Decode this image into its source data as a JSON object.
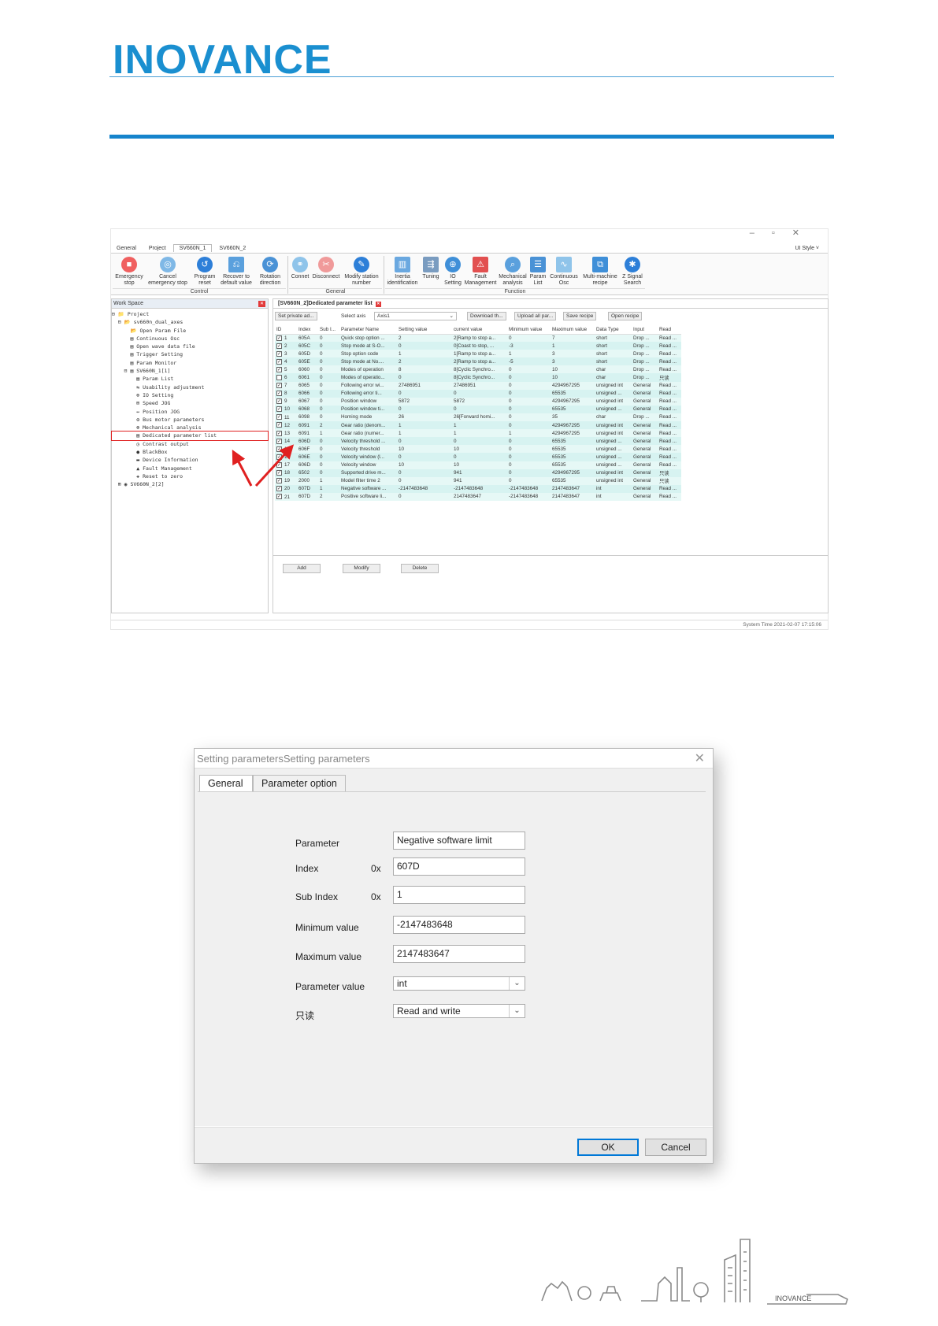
{
  "brand": {
    "logo_text": "INOVANCE",
    "color": "#1a8fd0"
  },
  "app": {
    "menu": [
      "General",
      "Project",
      "SV660N_1",
      "SV660N_2"
    ],
    "style_label": "UI Style ˅",
    "ribbon": {
      "control": [
        {
          "label": "Emergency\nstop",
          "icon": "stop-icon"
        },
        {
          "label": "Cancel\nemergency stop",
          "icon": "cancel-stop-icon"
        },
        {
          "label": "Program\nreset",
          "icon": "reset-icon"
        },
        {
          "label": "Recover to\ndefault value",
          "icon": "restore-icon"
        },
        {
          "label": "Rotation\ndirection",
          "icon": "rotation-icon"
        }
      ],
      "general": [
        {
          "label": "Connet",
          "icon": "connect-icon"
        },
        {
          "label": "Disconnect",
          "icon": "disconnect-icon"
        },
        {
          "label": "Modify station\nnumber",
          "icon": "edit-icon"
        }
      ],
      "function": [
        {
          "label": "Inertia\nidentification",
          "icon": "inertia-icon"
        },
        {
          "label": "Tuning",
          "icon": "tuning-icon"
        },
        {
          "label": "IO\nSetting",
          "icon": "io-icon"
        },
        {
          "label": "Fault\nManagement",
          "icon": "fault-icon"
        },
        {
          "label": "Mechanical\nanalysis",
          "icon": "analysis-icon"
        },
        {
          "label": "Param\nList",
          "icon": "list-icon"
        },
        {
          "label": "Continuous\nOsc",
          "icon": "osc-icon"
        },
        {
          "label": "Multi-machine\nrecipe",
          "icon": "recipe-icon"
        },
        {
          "label": "Z Signal\nSearch",
          "icon": "signal-icon"
        }
      ],
      "group_labels": [
        "Control",
        "General",
        "Function"
      ]
    },
    "workspace": {
      "title": "Work Space",
      "tree": [
        "⊟ 📁 Project",
        "  ⊟ 📂 sv660n_dual_axes",
        "      📂 Open Param File",
        "      ▤ Continuous Osc",
        "      ▤ Open wave data file",
        "      ▤ Trigger Setting",
        "      ▤ Param Monitor",
        "    ⊟ ▤ SV660N_1[1]",
        "        ▤ Param List",
        "        ⇆ Usability adjustment",
        "        ⊕ IO Setting",
        "        ⊞ Speed JOG",
        "        ↔ Position JOG",
        "        ⚙ Bus motor parameters",
        "        ⊛ Mechanical analysis",
        "        ▤ Dedicated parameter list",
        "        ◷ Contrast output",
        "        ● BlackBox",
        "        ▬ Device Information",
        "        ▲ Fault Management",
        "        ✚ Reset to zero",
        "  ⊞ ◉ SV660N_2[2]"
      ]
    },
    "pane": {
      "tab_title": "[SV660N_2]Dedicated parameter list",
      "toolbar": {
        "set_private": "Set private ad...",
        "select_axis_label": "Select axis",
        "axis_value": "Axis1",
        "download": "Download th...",
        "upload": "Upload all par...",
        "save_recipe": "Save recipe",
        "open_recipe": "Open recipe"
      },
      "columns": [
        "ID",
        "Index",
        "Sub I...",
        "Parameter Name",
        "Setting value",
        "current value",
        "Minimum value",
        "Maximum value",
        "Data Type",
        "Input",
        "Read"
      ],
      "rows": [
        [
          "1",
          "605A",
          "0",
          "Quick stop option ...",
          "2",
          "2[Ramp to stop a...",
          "0",
          "7",
          "short",
          "Drop ...",
          "Read ..."
        ],
        [
          "2",
          "605C",
          "0",
          "Stop mode at S-O...",
          "0",
          "0[Coast to stop, ...",
          "-3",
          "1",
          "short",
          "Drop ...",
          "Read ..."
        ],
        [
          "3",
          "605D",
          "0",
          "Stop option code",
          "1",
          "1[Ramp to stop a...",
          "1",
          "3",
          "short",
          "Drop ...",
          "Read ..."
        ],
        [
          "4",
          "605E",
          "0",
          "Stop mode at No....",
          "2",
          "2[Ramp to stop a...",
          "-5",
          "3",
          "short",
          "Drop ...",
          "Read ..."
        ],
        [
          "5",
          "6060",
          "0",
          "Modes of operation",
          "8",
          "8[Cyclic Synchro...",
          "0",
          "10",
          "char",
          "Drop ...",
          "Read ..."
        ],
        [
          "6",
          "6061",
          "0",
          "Modes of operatio...",
          "0",
          "8[Cyclic Synchro...",
          "0",
          "10",
          "char",
          "Drop ...",
          "只读"
        ],
        [
          "7",
          "6065",
          "0",
          "Following error wi...",
          "27486951",
          "27486951",
          "0",
          "4294967295",
          "unsigned int",
          "General",
          "Read ..."
        ],
        [
          "8",
          "6066",
          "0",
          "Following error ti...",
          "0",
          "0",
          "0",
          "65535",
          "unsigned ...",
          "General",
          "Read ..."
        ],
        [
          "9",
          "6067",
          "0",
          "Position window",
          "5872",
          "5872",
          "0",
          "4294967295",
          "unsigned int",
          "General",
          "Read ..."
        ],
        [
          "10",
          "6068",
          "0",
          "Position window ti...",
          "0",
          "0",
          "0",
          "65535",
          "unsigned ...",
          "General",
          "Read ..."
        ],
        [
          "11",
          "6098",
          "0",
          "Homing mode",
          "26",
          "26[Forward homi...",
          "0",
          "35",
          "char",
          "Drop ...",
          "Read ..."
        ],
        [
          "12",
          "6091",
          "2",
          "Gear ratio (denom...",
          "1",
          "1",
          "0",
          "4294967295",
          "unsigned int",
          "General",
          "Read ..."
        ],
        [
          "13",
          "6091",
          "1",
          "Gear ratio (numer...",
          "1",
          "1",
          "1",
          "4294967295",
          "unsigned int",
          "General",
          "Read ..."
        ],
        [
          "14",
          "606D",
          "0",
          "Velocity threshold ...",
          "0",
          "0",
          "0",
          "65535",
          "unsigned ...",
          "General",
          "Read ..."
        ],
        [
          "15",
          "606F",
          "0",
          "Velocity threshold",
          "10",
          "10",
          "0",
          "65535",
          "unsigned ...",
          "General",
          "Read ..."
        ],
        [
          "16",
          "606E",
          "0",
          "Velocity window (l...",
          "0",
          "0",
          "0",
          "65535",
          "unsigned ...",
          "General",
          "Read ..."
        ],
        [
          "17",
          "606D",
          "0",
          "Velocity window",
          "10",
          "10",
          "0",
          "65535",
          "unsigned ...",
          "General",
          "Read ..."
        ],
        [
          "18",
          "6502",
          "0",
          "Supported drive m...",
          "0",
          "941",
          "0",
          "4294967295",
          "unsigned int",
          "General",
          "只读"
        ],
        [
          "19",
          "2000",
          "1",
          "Model filter time 2",
          "0",
          "941",
          "0",
          "65535",
          "unsigned int",
          "General",
          "只读"
        ],
        [
          "20",
          "607D",
          "1",
          "Negative software ...",
          "-2147483648",
          "-2147483648",
          "-2147483648",
          "2147483647",
          "int",
          "General",
          "Read ..."
        ],
        [
          "21",
          "607D",
          "2",
          "Positive software li...",
          "0",
          "2147483647",
          "-2147483648",
          "2147483647",
          "int",
          "General",
          "Read ..."
        ]
      ],
      "checked": [
        true,
        true,
        true,
        true,
        true,
        false,
        true,
        true,
        true,
        true,
        true,
        true,
        true,
        true,
        true,
        true,
        true,
        true,
        true,
        true,
        true
      ],
      "buttons": [
        "Add",
        "Modify",
        "Delete"
      ]
    },
    "status": "System Time  2021-02-07 17:15:06"
  },
  "dialog": {
    "title": "Setting parametersSetting parameters",
    "tabs": [
      "General",
      "Parameter option"
    ],
    "fields": {
      "parameter_label": "Parameter",
      "parameter_value": "Negative software limit",
      "index_label": "Index",
      "index_prefix": "0x",
      "index_value": "607D",
      "subindex_label": "Sub Index",
      "subindex_prefix": "0x",
      "subindex_value": "1",
      "min_label": "Minimum value",
      "min_value": "-2147483648",
      "max_label": "Maximum value",
      "max_value": "2147483647",
      "type_label": "Parameter value",
      "type_value": "int",
      "readonly_label": "只读",
      "readonly_value": "Read and write"
    },
    "ok": "OK",
    "cancel": "Cancel"
  },
  "footer": {
    "brand_text": "INOVANCE"
  }
}
